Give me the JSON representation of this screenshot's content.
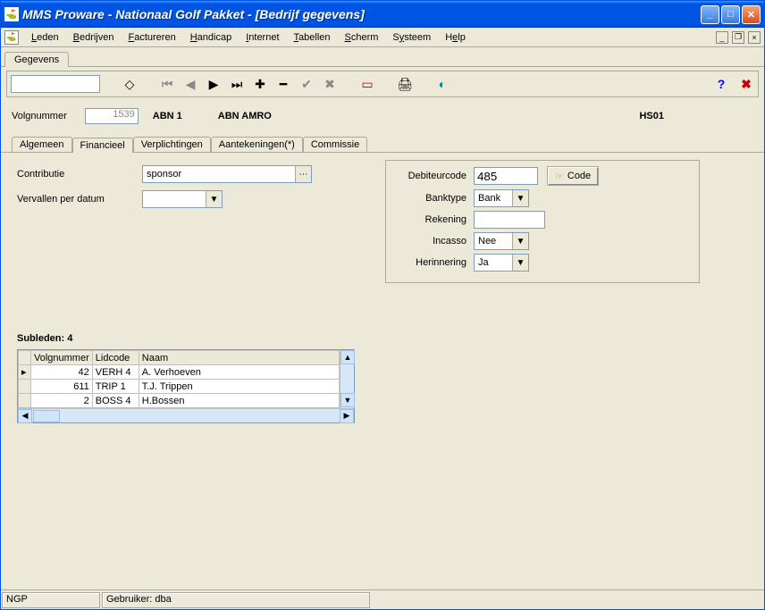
{
  "window": {
    "title": "MMS Proware - Nationaal Golf Pakket - [Bedrijf gegevens]"
  },
  "menu": {
    "items": [
      "Leden",
      "Bedrijven",
      "Factureren",
      "Handicap",
      "Internet",
      "Tabellen",
      "Scherm",
      "Systeem",
      "Help"
    ]
  },
  "subtab": {
    "label": "Gegevens"
  },
  "info": {
    "label_volgnummer": "Volgnummer",
    "volgnummer": "1539",
    "abn": "ABN  1",
    "company": "ABN AMRO",
    "code_right": "HS01"
  },
  "tabs": {
    "items": [
      "Algemeen",
      "Financieel",
      "Verplichtingen",
      "Aantekeningen(*)",
      "Commissie"
    ],
    "active_index": 1
  },
  "form": {
    "contributie_label": "Contributie",
    "contributie_value": "sponsor",
    "vervallen_label": "Vervallen per datum",
    "vervallen_value": ""
  },
  "debtor": {
    "debcode_label": "Debiteurcode",
    "debcode_value": "485",
    "code_button": "Code",
    "banktype_label": "Banktype",
    "banktype_value": "Bank",
    "rekening_label": "Rekening",
    "rekening_value": "",
    "incasso_label": "Incasso",
    "incasso_value": "Nee",
    "herinnering_label": "Herinnering",
    "herinnering_value": "Ja"
  },
  "subleden": {
    "title": "Subleden: 4",
    "headers": {
      "volgnummer": "Volgnummer",
      "lidcode": "Lidcode",
      "naam": "Naam"
    },
    "rows": [
      {
        "volgnummer": "42",
        "lidcode": "VERH 4",
        "naam": "A. Verhoeven"
      },
      {
        "volgnummer": "611",
        "lidcode": "TRIP 1",
        "naam": "T.J. Trippen"
      },
      {
        "volgnummer": "2",
        "lidcode": "BOSS 4",
        "naam": "H.Bossen"
      }
    ]
  },
  "status": {
    "left": "NGP",
    "user_prefix": "Gebruiker: ",
    "user": "dba"
  }
}
